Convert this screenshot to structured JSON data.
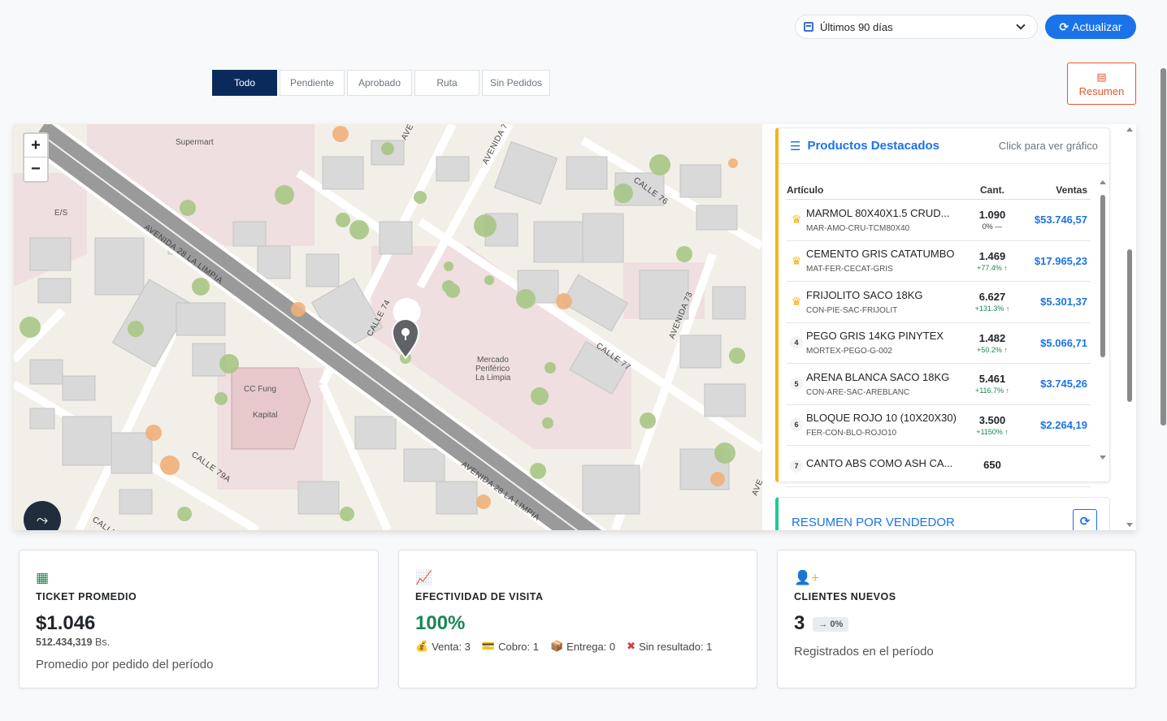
{
  "toolbar": {
    "period_value": "Últimos 90 días",
    "refresh_label": "Actualizar",
    "refresh_icon": "refresh-icon",
    "calendar_icon": "calendar-icon"
  },
  "tabs": [
    {
      "label": "Todo",
      "active": true
    },
    {
      "label": "Pendiente",
      "active": false
    },
    {
      "label": "Aprobado",
      "active": false
    },
    {
      "label": "Ruta",
      "active": false
    },
    {
      "label": "Sin Pedidos",
      "active": false
    }
  ],
  "resumen_button": {
    "label": "Resumen",
    "icon": "bar-chart-icon"
  },
  "map": {
    "zoom_in": "+",
    "zoom_out": "−",
    "labels": {
      "supermart": "Supermart",
      "es": "E/S",
      "avenida_28_a": "AVENIDA 28 LA LIMPIA",
      "avenida_28_b": "AVENIDA 28 LA LIMPIA",
      "calle_74": "CALLE 74",
      "calle_76": "CALLE 76",
      "calle_77": "CALLE 77",
      "calle_79a": "CALLE 79A",
      "avenida_73": "AVENIDA 73",
      "avenida_7": "AVENIDA 7",
      "ave": "AVE",
      "calle": "CALLE",
      "ave_right": "AVE",
      "mercado_1": "Mercado",
      "mercado_2": "Periférico",
      "mercado_3": "La Limpia",
      "cc_1": "CC Fung",
      "cc_2": "Kapital"
    }
  },
  "products": {
    "title": "Productos Destacados",
    "hint": "Click para ver gráfico",
    "columns": {
      "article": "Artículo",
      "qty": "Cant.",
      "sales": "Ventas"
    },
    "rows": [
      {
        "rank": "1",
        "crown": true,
        "name": "MARMOL 80X40X1.5 CRUD...",
        "code": "MAR-AMO-CRU-TCM80X40",
        "qty": "1.090",
        "var": "0% —",
        "up": false,
        "sales": "$53.746,57"
      },
      {
        "rank": "2",
        "crown": true,
        "name": "CEMENTO GRIS CATATUMBO",
        "code": "MAT-FER-CECAT-GRIS",
        "qty": "1.469",
        "var": "+77.4% ↑",
        "up": true,
        "sales": "$17.965,23"
      },
      {
        "rank": "3",
        "crown": true,
        "name": "FRIJOLITO SACO 18KG",
        "code": "CON-PIE-SAC-FRIJOLIT",
        "qty": "6.627",
        "var": "+131.3% ↑",
        "up": true,
        "sales": "$5.301,37"
      },
      {
        "rank": "4",
        "crown": false,
        "name": "PEGO GRIS 14KG PINYTEX",
        "code": "MORTEX-PEGO-G-002",
        "qty": "1.482",
        "var": "+50.2% ↑",
        "up": true,
        "sales": "$5.066,71"
      },
      {
        "rank": "5",
        "crown": false,
        "name": "ARENA BLANCA SACO 18KG",
        "code": "CON-ARE-SAC-AREBLANC",
        "qty": "5.461",
        "var": "+116.7% ↑",
        "up": true,
        "sales": "$3.745,26"
      },
      {
        "rank": "6",
        "crown": false,
        "name": "BLOQUE ROJO 10 (10X20X30)",
        "code": "FER-CON-BLO-ROJO10",
        "qty": "3.500",
        "var": "+1150% ↑",
        "up": true,
        "sales": "$2.264,19"
      },
      {
        "rank": "7",
        "crown": false,
        "name": "CANTO ABS COMO ASH CA...",
        "code": "",
        "qty": "650",
        "var": "",
        "up": true,
        "sales": ""
      }
    ]
  },
  "vendor": {
    "title": "RESUMEN POR VENDEDOR"
  },
  "kpis": {
    "ticket": {
      "icon": "receipt-icon",
      "label": "TICKET PROMEDIO",
      "value": "$1.046",
      "sub_value": "512.434,319",
      "sub_unit": "Bs.",
      "desc": "Promedio por pedido del período"
    },
    "visit": {
      "icon": "line-chart-icon",
      "label": "EFECTIVIDAD DE VISITA",
      "value": "100%",
      "stats": [
        {
          "icon": "money-bag-icon",
          "glyph": "💰",
          "text": "Venta: 3"
        },
        {
          "icon": "card-icon",
          "glyph": "💳",
          "text": "Cobro: 1"
        },
        {
          "icon": "package-icon",
          "glyph": "📦",
          "text": "Entrega: 0"
        },
        {
          "icon": "cross-icon",
          "glyph": "✖",
          "text": "Sin resultado: 1"
        }
      ]
    },
    "clients": {
      "icon": "user-plus-icon",
      "label": "CLIENTES NUEVOS",
      "value": "3",
      "chip": "→ 0%",
      "desc": "Registrados en el período"
    }
  },
  "colors": {
    "primary": "#1a73e8",
    "navy": "#0b2a5c",
    "accent_orange": "#e4572e",
    "gold": "#f5b21a",
    "green": "#198754",
    "teal": "#20c997"
  }
}
